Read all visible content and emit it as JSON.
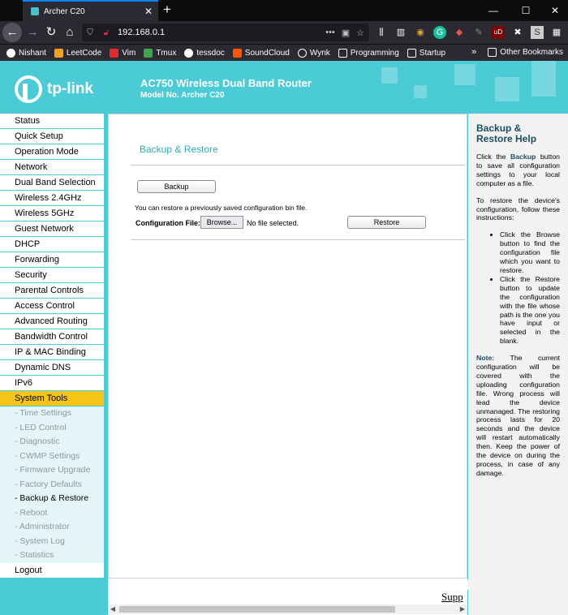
{
  "browser": {
    "tab_title": "Archer C20",
    "url": "192.168.0.1",
    "bookmarks": [
      "Nishant",
      "LeetCode",
      "Vim",
      "Tmux",
      "tessdoc",
      "SoundCloud",
      "Wynk",
      "Programming",
      "Startup"
    ],
    "other_bookmarks": "Other Bookmarks"
  },
  "header": {
    "logo": "tp-link",
    "title": "AC750 Wireless Dual Band Router",
    "model": "Model No. Archer C20"
  },
  "menu": {
    "top": [
      "Status",
      "Quick Setup",
      "Operation Mode",
      "Network",
      "Dual Band Selection",
      "Wireless 2.4GHz",
      "Wireless 5GHz",
      "Guest Network",
      "DHCP",
      "Forwarding",
      "Security",
      "Parental Controls",
      "Access Control",
      "Advanced Routing",
      "Bandwidth Control",
      "IP & MAC Binding",
      "Dynamic DNS",
      "IPv6"
    ],
    "active": "System Tools",
    "sub": [
      "- Time Settings",
      "- LED Control",
      "- Diagnostic",
      "- CWMP Settings",
      "- Firmware Upgrade",
      "- Factory Defaults",
      "- Backup & Restore",
      "- Reboot",
      "- Administrator",
      "- System Log",
      "- Statistics"
    ],
    "logout": "Logout"
  },
  "content": {
    "title": "Backup & Restore",
    "backup_button": "Backup",
    "restore_note": "You can restore a previously saved configuration bin file.",
    "config_label": "Configuration File:",
    "browse_button": "Browse...",
    "no_file": "No file selected.",
    "restore_button": "Restore",
    "footer_link": "Supp"
  },
  "help": {
    "title": "Backup & Restore Help",
    "p1_pre": "Click the ",
    "p1_bold": "Backup",
    "p1_post": " button to save all configuration settings to your local computer as a file.",
    "p2": "To restore the device's configuration, follow these instructions:",
    "bullet1": "Click the Browse button to find the configuration file which you want to restore.",
    "bullet2": "Click the Restore button to update the configuration with the file whose path is the one you have input or selected in the blank.",
    "note_label": "Note:",
    "note_text": " The current configuration will be covered with the uploading configuration file. Wrong process will lead the device unmanaged. The restoring process lasts for 20 seconds and the device will restart automatically then. Keep the power of the device on during the process, in case of any damage."
  }
}
